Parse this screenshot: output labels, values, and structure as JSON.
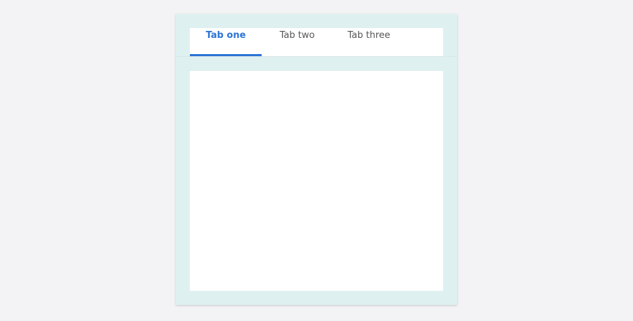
{
  "tabs": [
    {
      "label": "Tab one",
      "selected": true
    },
    {
      "label": "Tab two",
      "selected": false
    },
    {
      "label": "Tab three",
      "selected": false
    }
  ],
  "colors": {
    "page_background": "#f3f3f5",
    "card_background": "#dff0f0",
    "accent": "#2b74d6",
    "tab_text": "#555555"
  }
}
